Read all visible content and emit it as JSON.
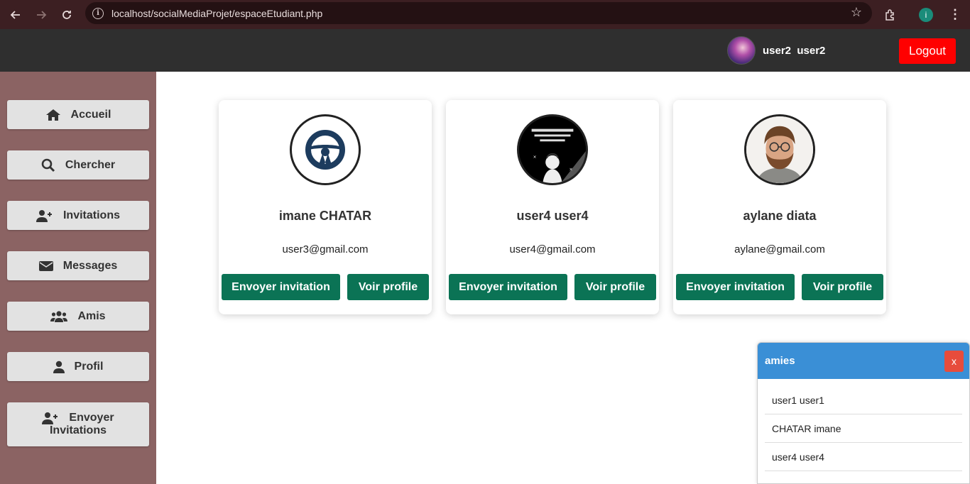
{
  "browser": {
    "url": "localhost/socialMediaProjet/espaceEtudiant.php",
    "profile_initial": "i"
  },
  "header": {
    "username": "user2  user2",
    "logout_label": "Logout",
    "logout_color": "#ff0000"
  },
  "sidebar": {
    "items": [
      {
        "label": "Accueil",
        "icon": "home-icon"
      },
      {
        "label": "Chercher",
        "icon": "search-icon"
      },
      {
        "label": "Invitations",
        "icon": "user-plus-icon"
      },
      {
        "label": "Messages",
        "icon": "envelope-icon"
      },
      {
        "label": "Amis",
        "icon": "users-icon"
      },
      {
        "label": "Profil",
        "icon": "user-icon"
      },
      {
        "label_line1": "Envoyer",
        "label_line2": "Invitations",
        "icon": "user-plus-icon"
      }
    ]
  },
  "cards": [
    {
      "name": "imane CHATAR",
      "email": "user3@gmail.com",
      "invite_label": "Envoyer invitation",
      "profile_label": "Voir profile",
      "avatar": "steering-wheel-icon"
    },
    {
      "name": "user4 user4",
      "email": "user4@gmail.com",
      "invite_label": "Envoyer invitation",
      "profile_label": "Voir profile",
      "avatar": "cartoon-avatar"
    },
    {
      "name": "aylane diata",
      "email": "aylane@gmail.com",
      "invite_label": "Envoyer invitation",
      "profile_label": "Voir profile",
      "avatar": "bearded-man-avatar"
    }
  ],
  "friends_panel": {
    "title": "amies",
    "close_label": "x",
    "items": [
      "user1 user1",
      "CHATAR imane",
      "user4 user4"
    ]
  },
  "colors": {
    "sidebar_bg": "#8b6363",
    "header_bg": "#2f2f2f",
    "button_green": "#0b7355",
    "panel_blue": "#3a8fd6"
  }
}
